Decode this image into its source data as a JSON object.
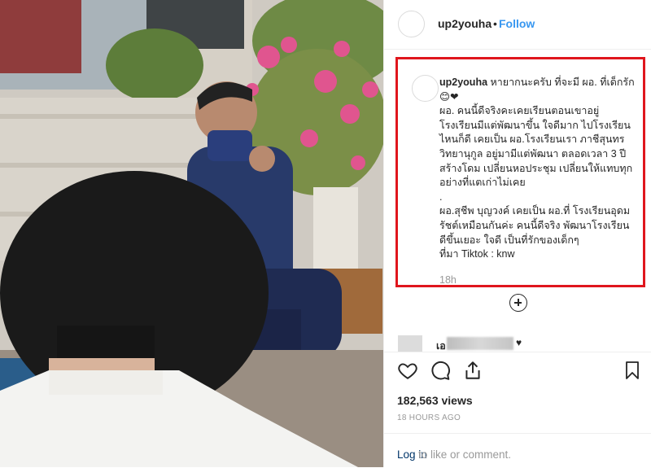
{
  "header": {
    "username": "up2youha",
    "separator": "•",
    "follow_label": "Follow"
  },
  "caption": {
    "username": "up2youha",
    "text": " หายากนะครับ ที่จะมี ผอ. ที่เด็กรัก 😊❤\nผอ. คนนี้ดีจริงคะเคยเรียนตอนเขาอยู่ โรงเรียนมีแต่พัฒนาขึ้น ใจดีมาก ไปโรงเรียนไหนก็ดี เคยเป็น ผอ.โรงเรียนเรา ภาชีสุนทรวิทยานุกูล อยู่มามีแต่พัฒนา ตลอดเวลา 3 ปี สร้างโดม เปลี่ยนหอประชุม เปลี่ยนให้แทบทุกอย่างที่แตเก่าไม่เคย\n.\nผอ.สุชีพ บุญวงค์ เคยเป็น ผอ.ที่ โรงเรียนอุดมรัชต์เหมือนกันค่ะ คนนี้ดีจริง พัฒนาโรงเรียนดีขึ้นเยอะ ใจดี เป็นที่รักของเด็กๆ\nที่มา Tiktok : knw",
    "time": "18h"
  },
  "comment": {
    "user_fragment": "เอ",
    "heart": "♥"
  },
  "icons": {
    "like": "heart-outline-icon",
    "comment": "speech-bubble-icon",
    "share": "share-arrow-icon",
    "save": "bookmark-icon",
    "load_more": "plus-circle-icon"
  },
  "stats": {
    "views": "182,563 views",
    "time_ago": "18 HOURS AGO"
  },
  "footer": {
    "login_label": "Log in",
    "login_rest": "to like or comment."
  },
  "colors": {
    "accent": "#3897f0",
    "highlight_box": "#e0161d",
    "muted": "#999999"
  }
}
